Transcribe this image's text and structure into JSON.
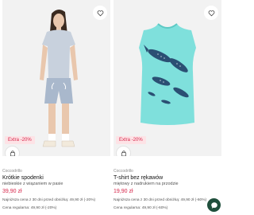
{
  "products": [
    {
      "badge": "Extra -20%",
      "brand": "Coccodrillo",
      "name": "Krótkie spodenki",
      "desc": "niebieskie z wiązaniem w pasie",
      "price": "39,90 zł",
      "lowest": "Najniższa cena z 30 dni przed obniżką: 49,90 zł (-20%)",
      "regular": "Cena regularna: 49,90 zł (-20%)"
    },
    {
      "badge": "Extra -20%",
      "brand": "Coccodrillo",
      "name": "T-shirt bez rękawów",
      "desc": "miętowy z nadrukiem na przodzie",
      "price": "19,90 zł",
      "lowest": "Najniższa cena z 30 dni przed obniżką: 49,90 zł (-60%)",
      "regular": "Cena regularna: 49,90 zł (-60%)"
    }
  ],
  "colors": {
    "accent": "#d6264a",
    "badge_bg": "#fde3e6",
    "chat_bg": "#1f4f3c",
    "shirt": "#7fe0dc"
  },
  "icons": {
    "favorite": "heart-icon",
    "cart": "shopping-bag-icon",
    "chat": "chat-bubble-icon"
  }
}
